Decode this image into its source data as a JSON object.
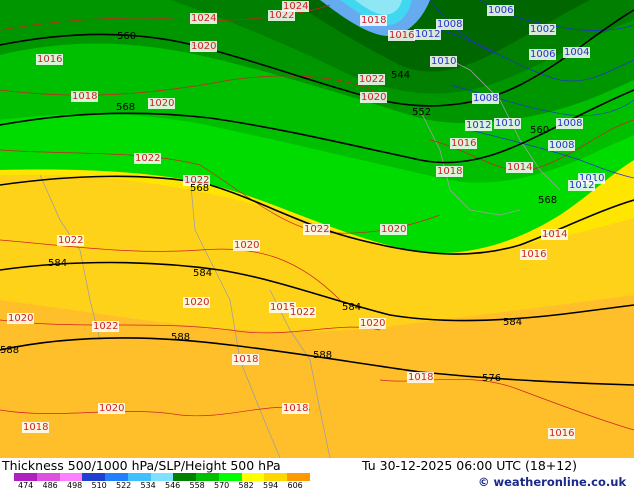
{
  "map": {
    "isobar_labels": [
      {
        "text": "1024",
        "kind": "ctr"
      },
      {
        "text": "1022",
        "kind": "ctr"
      },
      {
        "text": "1024",
        "kind": "ctr"
      },
      {
        "text": "1018",
        "kind": "ctr"
      },
      {
        "text": "1016",
        "kind": "ctr"
      },
      {
        "text": "1012",
        "kind": "blue"
      },
      {
        "text": "1008",
        "kind": "blue"
      },
      {
        "text": "1006",
        "kind": "blue"
      },
      {
        "text": "1002",
        "kind": "blue"
      },
      {
        "text": "1006",
        "kind": "blue"
      },
      {
        "text": "1004",
        "kind": "blue"
      },
      {
        "text": "1020",
        "kind": "ctr"
      },
      {
        "text": "1016",
        "kind": "ctr"
      },
      {
        "text": "1010",
        "kind": "blue"
      },
      {
        "text": "1022",
        "kind": "ctr"
      },
      {
        "text": "1020",
        "kind": "ctr"
      },
      {
        "text": "1018",
        "kind": "ctr"
      },
      {
        "text": "1020",
        "kind": "ctr"
      },
      {
        "text": "1008",
        "kind": "blue"
      },
      {
        "text": "1012",
        "kind": "blue"
      },
      {
        "text": "1010",
        "kind": "blue"
      },
      {
        "text": "1008",
        "kind": "blue"
      },
      {
        "text": "1016",
        "kind": "ctr"
      },
      {
        "text": "1008",
        "kind": "blue"
      },
      {
        "text": "1022",
        "kind": "ctr"
      },
      {
        "text": "1018",
        "kind": "ctr"
      },
      {
        "text": "1014",
        "kind": "ctr"
      },
      {
        "text": "1010",
        "kind": "blue"
      },
      {
        "text": "1012",
        "kind": "blue"
      },
      {
        "text": "1022",
        "kind": "ctr"
      },
      {
        "text": "1022",
        "kind": "ctr"
      },
      {
        "text": "1020",
        "kind": "ctr"
      },
      {
        "text": "1020",
        "kind": "ctr"
      },
      {
        "text": "1014",
        "kind": "ctr"
      },
      {
        "text": "1016",
        "kind": "ctr"
      },
      {
        "text": "1022",
        "kind": "ctr"
      },
      {
        "text": "1020",
        "kind": "ctr"
      },
      {
        "text": "1015",
        "kind": "ctr"
      },
      {
        "text": "1022",
        "kind": "ctr"
      },
      {
        "text": "1020",
        "kind": "ctr"
      },
      {
        "text": "1022",
        "kind": "ctr"
      },
      {
        "text": "1020",
        "kind": "ctr"
      },
      {
        "text": "1018",
        "kind": "ctr"
      },
      {
        "text": "1018",
        "kind": "ctr"
      },
      {
        "text": "1020",
        "kind": "ctr"
      },
      {
        "text": "1018",
        "kind": "ctr"
      },
      {
        "text": "1018",
        "kind": "ctr"
      },
      {
        "text": "1016",
        "kind": "ctr"
      }
    ],
    "height_labels": [
      "560",
      "544",
      "552",
      "568",
      "560",
      "568",
      "568",
      "584",
      "584",
      "584",
      "584",
      "588",
      "588",
      "588",
      "576"
    ],
    "isobar_colors": {
      "high": "#cc2222",
      "low": "#2233cc"
    },
    "band_colors": {
      "g560": "#008f00",
      "g552": "#007800",
      "g544": "#006400",
      "g568": "#00be00",
      "g576": "#00dc00",
      "y584": "#ffe600",
      "o588": "#ffd21a",
      "o594": "#ffbf2a",
      "c536": "#40d8f0",
      "c528": "#66aaf0"
    }
  },
  "footer": {
    "title": "Thickness 500/1000 hPa/SLP/Height 500 hPa",
    "time": "Tu 30-12-2025 06:00 UTC (18+12)",
    "copyright": "© weatheronline.co.uk",
    "scale_values": [
      "474",
      "486",
      "498",
      "510",
      "522",
      "534",
      "546",
      "558",
      "570",
      "582",
      "594",
      "606"
    ],
    "scale_colors": [
      "#b020c0",
      "#e050e0",
      "#ff80ff",
      "#2040d0",
      "#2080ff",
      "#40c0ff",
      "#80e0ff",
      "#008000",
      "#00c000",
      "#00ff00",
      "#ffff00",
      "#ffd700",
      "#ff9900"
    ]
  }
}
